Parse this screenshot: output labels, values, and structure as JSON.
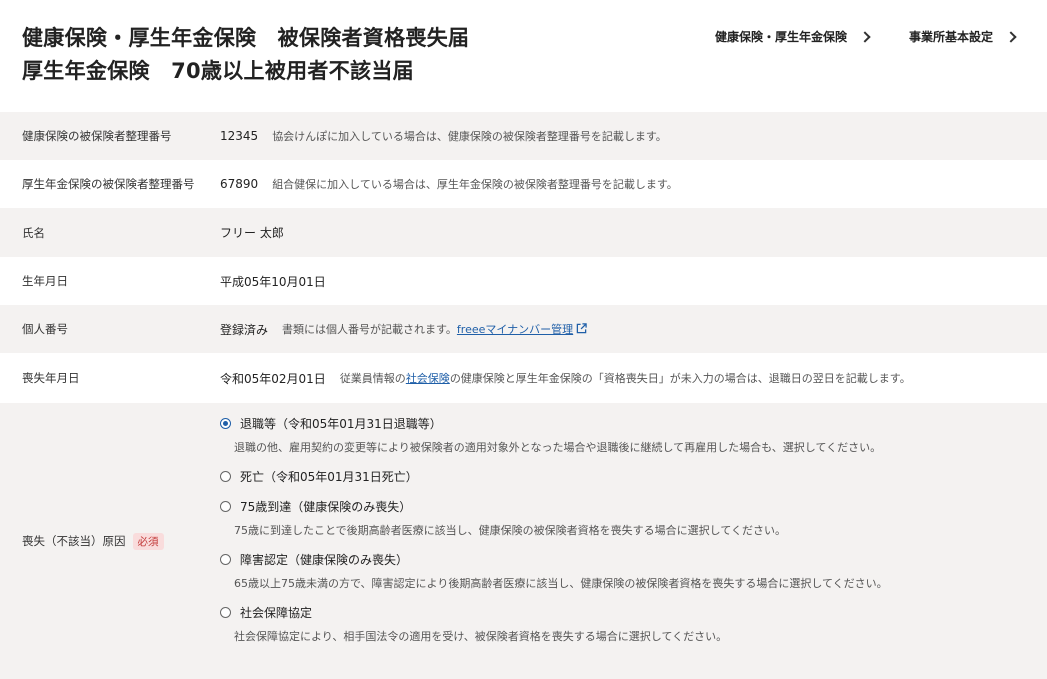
{
  "header": {
    "title_line1": "健康保険・厚生年金保険　被保険者資格喪失届",
    "title_line2": "厚生年金保険　70歳以上被用者不該当届",
    "links": [
      {
        "label": "健康保険・厚生年金保険"
      },
      {
        "label": "事業所基本設定"
      }
    ]
  },
  "rows": [
    {
      "label": "健康保険の被保険者整理番号",
      "value": "12345",
      "note": "協会けんぽに加入している場合は、健康保険の被保険者整理番号を記載します。"
    },
    {
      "label": "厚生年金保険の被保険者整理番号",
      "value": "67890",
      "note": "組合健保に加入している場合は、厚生年金保険の被保険者整理番号を記載します。"
    },
    {
      "label": "氏名",
      "value": "フリー 太郎"
    },
    {
      "label": "生年月日",
      "value": "平成05年10月01日"
    },
    {
      "label": "個人番号",
      "value": "登録済み",
      "note": "書類には個人番号が記載されます。",
      "link": "freeeマイナンバー管理"
    },
    {
      "label": "喪失年月日",
      "value": "令和05年02月01日",
      "note_prefix": "従業員情報の",
      "note_link": "社会保険",
      "note_suffix": "の健康保険と厚生年金保険の「資格喪失日」が未入力の場合は、退職日の翌日を記載します。"
    }
  ],
  "reason": {
    "label": "喪失（不該当）原因",
    "required": "必須",
    "options": [
      {
        "label": "退職等（令和05年01月31日退職等）",
        "checked": true,
        "desc": "退職の他、雇用契約の変更等により被保険者の適用対象外となった場合や退職後に継続して再雇用した場合も、選択してください。"
      },
      {
        "label": "死亡（令和05年01月31日死亡）",
        "checked": false,
        "desc": ""
      },
      {
        "label": "75歳到達（健康保険のみ喪失）",
        "checked": false,
        "desc": "75歳に到達したことで後期高齢者医療に該当し、健康保険の被保険者資格を喪失する場合に選択してください。"
      },
      {
        "label": "障害認定（健康保険のみ喪失）",
        "checked": false,
        "desc": "65歳以上75歳未満の方で、障害認定により後期高齢者医療に該当し、健康保険の被保険者資格を喪失する場合に選択してください。"
      },
      {
        "label": "社会保障協定",
        "checked": false,
        "desc": "社会保障協定により、相手国法令の適用を受け、被保険者資格を喪失する場合に選択してください。"
      }
    ]
  },
  "colors": {
    "accent": "#1f5fa8",
    "row_alt_bg": "#f4f2f1",
    "required_bg": "#f9dcdc",
    "required_text": "#c23838"
  }
}
